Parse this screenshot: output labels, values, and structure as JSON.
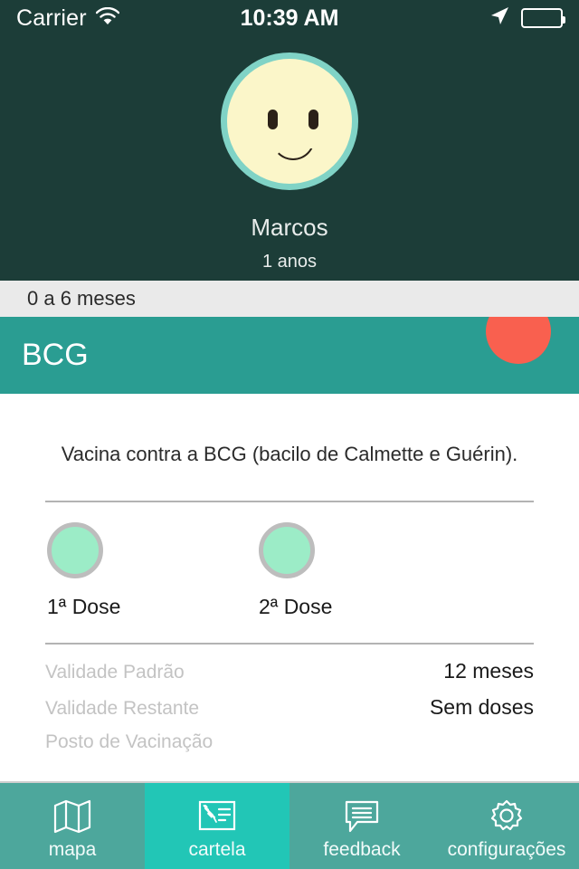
{
  "status_bar": {
    "carrier": "Carrier",
    "time": "10:39 AM",
    "wifi_icon": "wifi-icon",
    "location_icon": "location-arrow-icon",
    "battery_icon": "battery-icon"
  },
  "profile": {
    "avatar_icon": "smiley-face-avatar",
    "name": "Marcos",
    "age": "1 anos",
    "background_color": "#1c3d38",
    "avatar_fill": "#fbf6c9",
    "avatar_ring": "#80d3c6"
  },
  "section": {
    "header": "0 a 6 meses"
  },
  "vaccine": {
    "title": "BCG",
    "bar_color": "#2a9d92",
    "status_dot_color": "#f9604f",
    "status_dot_name": "status-dot-pending",
    "description": "Vacina contra a BCG (bacilo de Calmette e Guérin).",
    "doses": [
      {
        "label": "1ª Dose",
        "fill": "#9cecc7"
      },
      {
        "label": "2ª Dose",
        "fill": "#9cecc7"
      }
    ],
    "info": [
      {
        "label": "Validade Padrão",
        "value": "12 meses"
      },
      {
        "label": "Validade Restante",
        "value": "Sem doses"
      },
      {
        "label": "Posto de Vacinação",
        "value": ""
      }
    ]
  },
  "tabs": [
    {
      "label": "mapa",
      "icon": "map-icon",
      "active": false
    },
    {
      "label": "cartela",
      "icon": "vaccination-card-icon",
      "active": true
    },
    {
      "label": "feedback",
      "icon": "speech-bubble-icon",
      "active": false
    },
    {
      "label": "configurações",
      "icon": "gear-icon",
      "active": false
    }
  ]
}
